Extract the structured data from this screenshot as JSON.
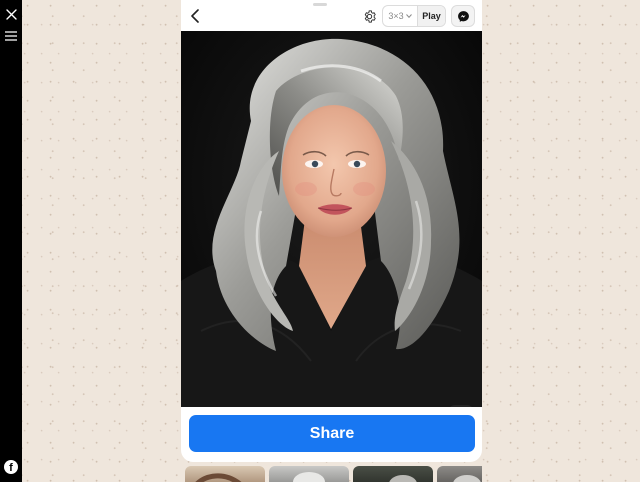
{
  "rail": {
    "close_icon": "close-icon",
    "menu_icon": "hamburger-menu-icon",
    "facebook_icon": "facebook-icon",
    "facebook_glyph": "f"
  },
  "topbar": {
    "back_icon": "chevron-left-icon",
    "settings_icon": "gear-icon",
    "grid_label": "3×3",
    "play_label": "Play",
    "messenger_icon": "messenger-icon"
  },
  "photo": {
    "download_icon": "download-icon"
  },
  "share": {
    "label": "Share"
  },
  "colors": {
    "accent": "#1877f2",
    "rail": "#000000",
    "background": "#efe6dc"
  }
}
